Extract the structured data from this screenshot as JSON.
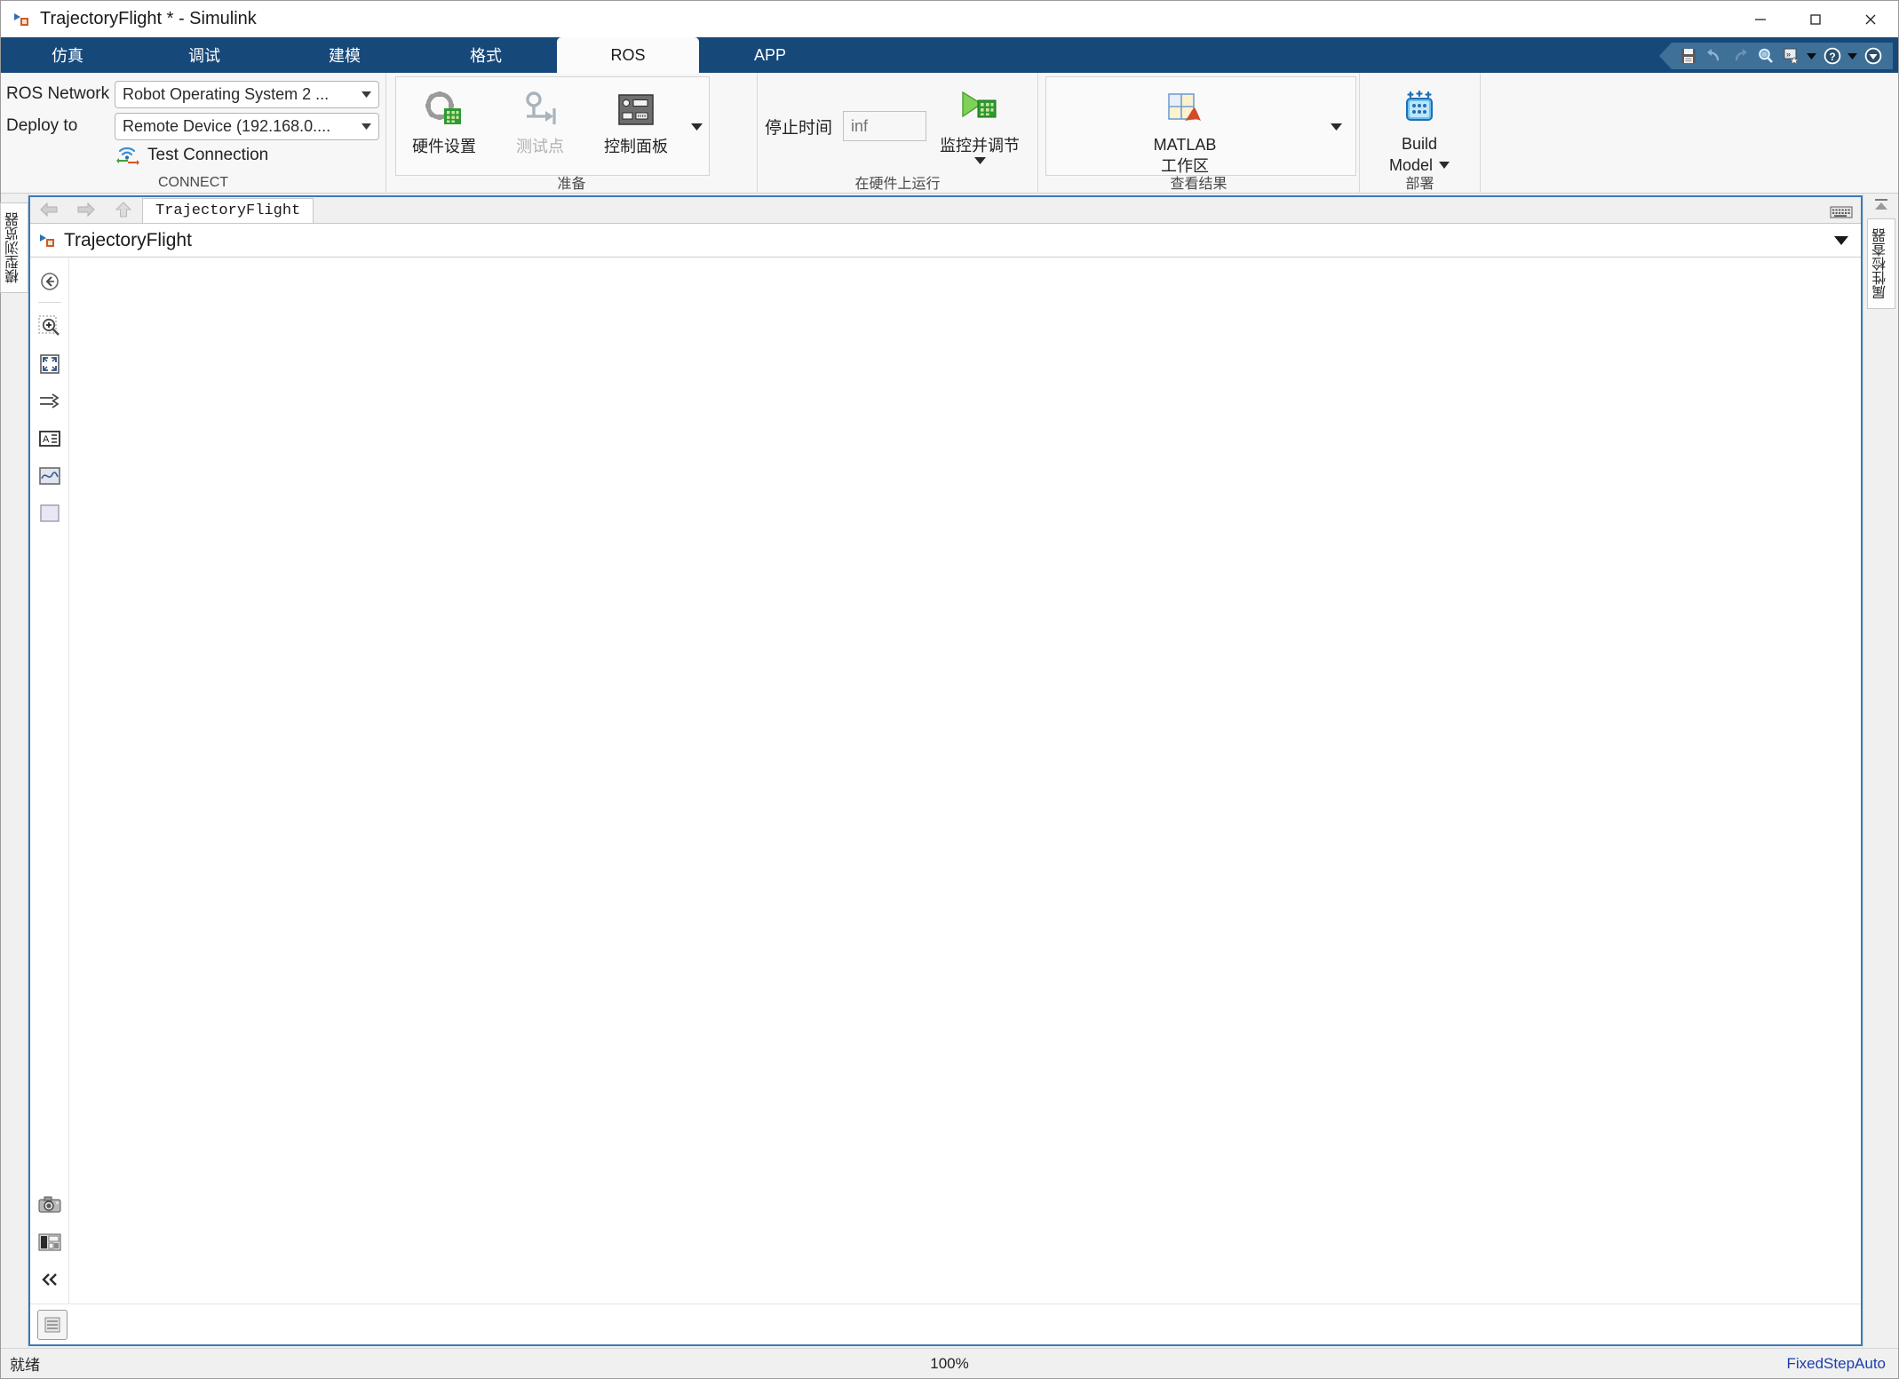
{
  "window": {
    "title": "TrajectoryFlight * - Simulink",
    "app_icon": "simulink-model-icon",
    "minimize_label": "—",
    "maximize_label": "□",
    "close_label": "✕"
  },
  "ribbon_tabs": [
    {
      "label": "仿真",
      "name": "tab-simulation",
      "active": false
    },
    {
      "label": "调试",
      "name": "tab-debug",
      "active": false
    },
    {
      "label": "建模",
      "name": "tab-modeling",
      "active": false
    },
    {
      "label": "格式",
      "name": "tab-format",
      "active": false
    },
    {
      "label": "ROS",
      "name": "tab-ros",
      "active": true
    },
    {
      "label": "APP",
      "name": "tab-app",
      "active": false
    }
  ],
  "quick_access": [
    {
      "name": "save-icon",
      "title": "Save"
    },
    {
      "name": "undo-icon",
      "title": "Undo"
    },
    {
      "name": "redo-icon",
      "title": "Redo"
    },
    {
      "name": "search-icon",
      "title": "Search"
    },
    {
      "name": "fast-restart-icon",
      "title": "Fast Restart"
    },
    {
      "name": "help-icon",
      "title": "Help"
    },
    {
      "name": "customize-icon",
      "title": "Customize"
    }
  ],
  "ribbon": {
    "connect": {
      "group_label": "CONNECT",
      "ros_network_label": "ROS Network",
      "ros_network_value": "Robot Operating System 2 ...",
      "deploy_to_label": "Deploy to",
      "deploy_to_value": "Remote Device (192.168.0....",
      "test_connection_label": "Test Connection",
      "test_connection_icon": "wifi-exchange-icon"
    },
    "prepare": {
      "group_label": "准备",
      "buttons": [
        {
          "label": "硬件设置",
          "icon": "gear-chip-icon",
          "disabled": false,
          "name": "hardware-settings-button"
        },
        {
          "label": "测试点",
          "icon": "test-point-icon",
          "disabled": true,
          "name": "test-point-button"
        },
        {
          "label": "控制面板",
          "icon": "control-panel-icon",
          "disabled": false,
          "name": "control-panel-button"
        }
      ]
    },
    "run_on_hardware": {
      "group_label": "在硬件上运行",
      "stop_time_label": "停止时间",
      "stop_time_value": "",
      "stop_time_placeholder": "inf",
      "monitor_tune_label": "监控并调节",
      "monitor_tune_icon": "run-chip-icon"
    },
    "view_results": {
      "group_label": "查看结果",
      "matlab_workspace_line1": "MATLAB",
      "matlab_workspace_line2": "工作区",
      "matlab_workspace_icon": "matlab-workspace-icon"
    },
    "deploy": {
      "group_label": "部署",
      "build_model_line1": "Build",
      "build_model_line2": "Model",
      "build_model_icon": "build-chip-icon"
    }
  },
  "editor": {
    "nav": {
      "back_icon": "arrow-left-icon",
      "forward_icon": "arrow-right-icon",
      "up_icon": "arrow-up-icon"
    },
    "model_tab_label": "TrajectoryFlight",
    "keyboard_icon": "keyboard-icon",
    "breadcrumb_icon": "simulink-model-icon",
    "breadcrumb_label": "TrajectoryFlight",
    "breadcrumb_caret": "▾",
    "canvas_tools": [
      {
        "name": "navigate-back-tool",
        "icon": "circle-back-icon"
      },
      {
        "name": "zoom-region-tool",
        "icon": "zoom-in-icon"
      },
      {
        "name": "fit-to-view-tool",
        "icon": "fit-view-icon"
      },
      {
        "name": "signal-routing-tool",
        "icon": "signal-lines-icon"
      },
      {
        "name": "annotation-tool",
        "icon": "text-annotation-icon"
      },
      {
        "name": "scope-tool",
        "icon": "scope-icon"
      },
      {
        "name": "area-tool",
        "icon": "blank-box-icon"
      }
    ],
    "canvas_tools_bottom": [
      {
        "name": "screenshot-tool",
        "icon": "camera-icon"
      },
      {
        "name": "model-layout-tool",
        "icon": "layout-icon"
      },
      {
        "name": "collapse-toolbar",
        "icon": "double-chevron-left-icon"
      }
    ],
    "footer_chip_icon": "model-explorer-icon"
  },
  "left_dock": {
    "tab_label": "模型浏览器"
  },
  "right_dock": {
    "collapse_icon": "collapse-up-icon",
    "tab_label": "属性检查器"
  },
  "status_bar": {
    "left": "就绪",
    "center": "100%",
    "right": "FixedStepAuto"
  },
  "colors": {
    "ribbon_blue": "#16487a",
    "editor_border": "#3b7ab8",
    "status_accent": "#1c3faa",
    "qat_bg": "#3f7098"
  }
}
